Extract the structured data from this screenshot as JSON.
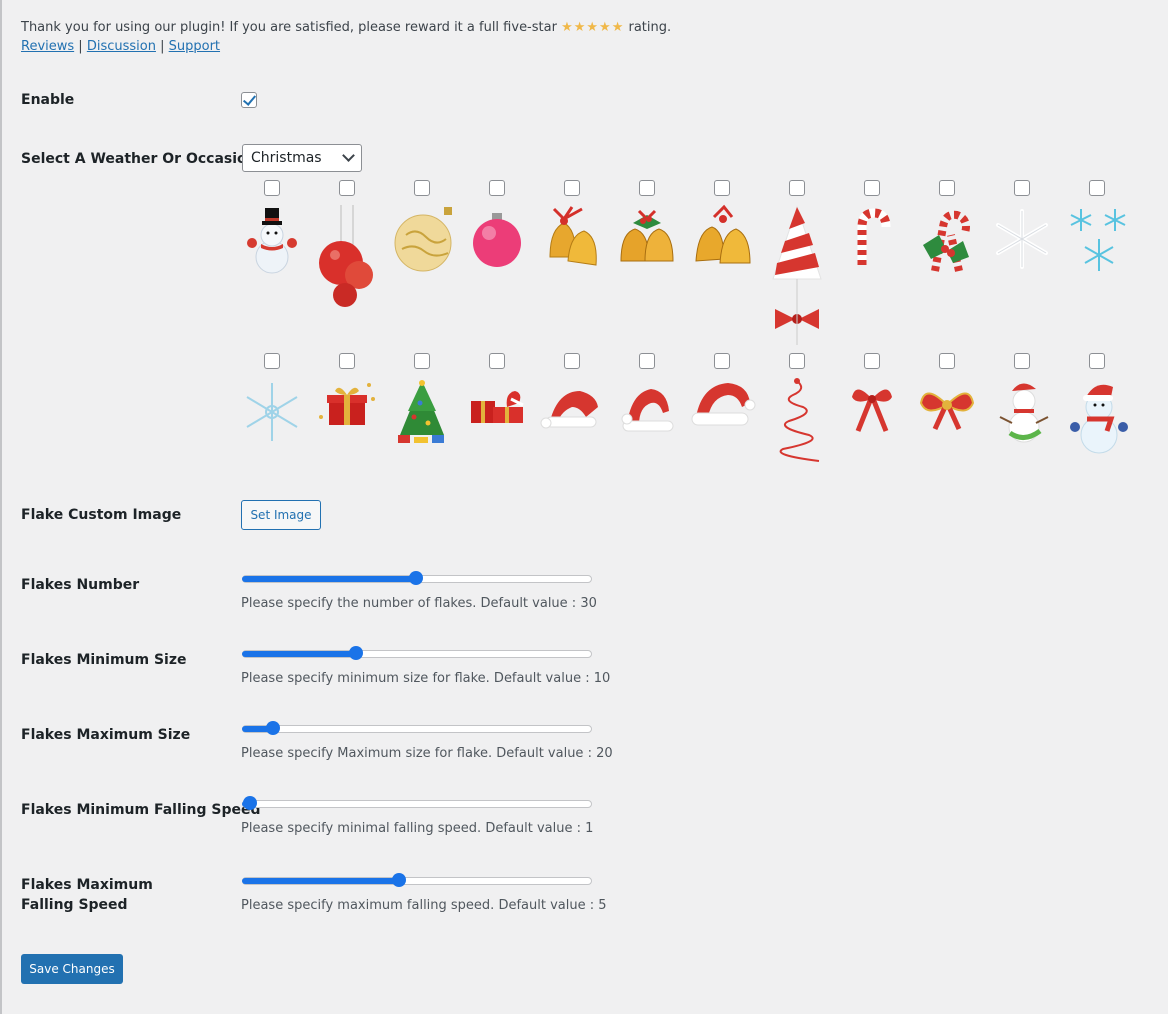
{
  "intro": {
    "text_before": "Thank you for using our plugin! If you are satisfied, please reward it a full five-star ",
    "stars": "★★★★★",
    "text_after": " rating.",
    "links": [
      "Reviews",
      "Discussion",
      "Support"
    ],
    "separator": "|"
  },
  "enable": {
    "label": "Enable",
    "checked": true
  },
  "weather": {
    "label": "Select A Weather Or Occasion",
    "selected": "Christmas"
  },
  "flake_icons": {
    "row1": [
      "snowman-top-hat-icon",
      "red-ornaments-icon",
      "gold-ornament-icon",
      "pink-ornament-icon",
      "gold-bells-ribbon-icon",
      "gold-bells-holly-icon",
      "gold-bells-icon",
      "striped-tree-bow-icon",
      "candy-cane-icon",
      "candy-canes-holly-icon",
      "white-snowflake-icon",
      "blue-snowflakes-icon"
    ],
    "row2": [
      "light-blue-snowflake-icon",
      "gift-box-stars-icon",
      "christmas-tree-icon",
      "gift-boxes-icon",
      "santa-hat-small-icon",
      "santa-hat-icon",
      "santa-hat-large-icon",
      "spiral-tree-icon",
      "red-bow-icon",
      "red-gold-bow-icon",
      "snowman-scarf-icon",
      "snowman-santa-hat-icon"
    ],
    "checked": []
  },
  "custom_image": {
    "label": "Flake Custom Image",
    "button": "Set Image"
  },
  "sliders": [
    {
      "label": "Flakes Number",
      "value": 0.5,
      "description": "Please specify the number of flakes. Default value : 30"
    },
    {
      "label": "Flakes Minimum Size",
      "value": 0.32,
      "description": "Please specify minimum size for flake. Default value : 10"
    },
    {
      "label": "Flakes Maximum Size",
      "value": 0.07,
      "description": "Please specify Maximum size for flake. Default value : 20"
    },
    {
      "label": "Flakes Minimum Falling Speed",
      "value": 0.0,
      "description": "Please specify minimal falling speed. Default value : 1"
    },
    {
      "label": "Flakes Maximum Falling Speed",
      "value": 0.45,
      "description": "Please specify maximum falling speed. Default value : 5"
    }
  ],
  "save_button": "Save Changes",
  "colors": {
    "accent": "#2271b1",
    "slider": "#1a73e8",
    "star": "#f0b849"
  }
}
